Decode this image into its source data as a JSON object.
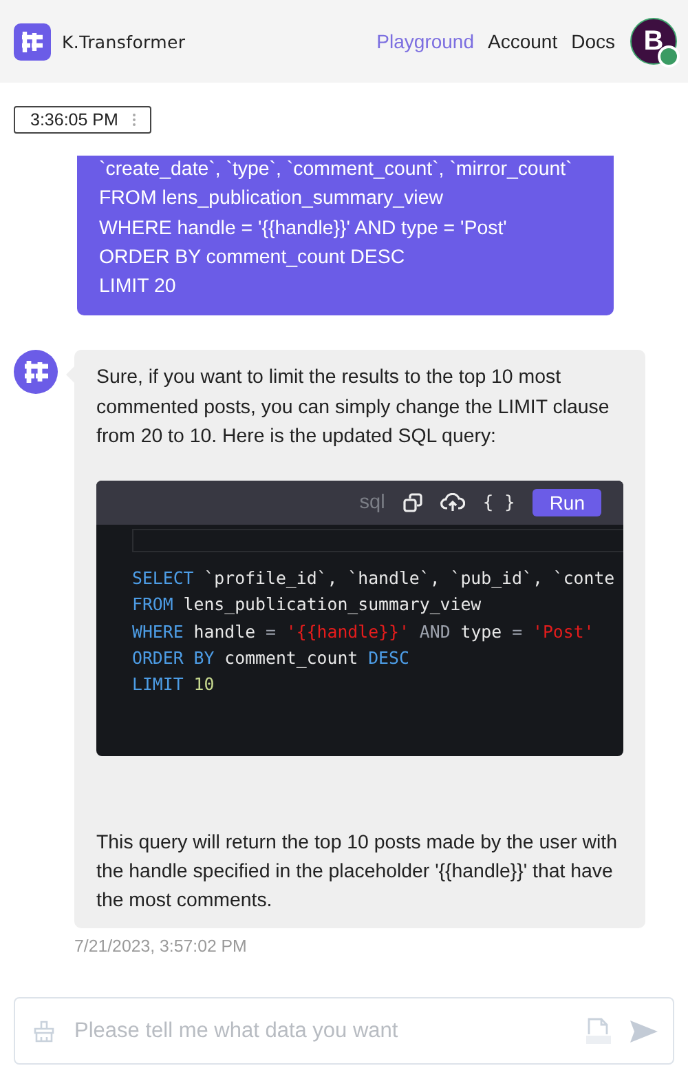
{
  "header": {
    "logo_text": "K.Transformer",
    "nav": [
      {
        "label": "Playground",
        "selected": true
      },
      {
        "label": "Account",
        "selected": false
      },
      {
        "label": "Docs",
        "selected": false
      }
    ],
    "avatar": {
      "initial": "B",
      "online": true
    }
  },
  "time_chip": {
    "time": "3:36:05 PM"
  },
  "user_message": {
    "lines": [
      "`create_date`, `type`, `comment_count`, `mirror_count`",
      "FROM lens_publication_summary_view",
      "WHERE handle = '{{handle}}' AND type = 'Post'",
      "ORDER BY comment_count DESC",
      "LIMIT 20"
    ]
  },
  "bot_message": {
    "intro": "Sure, if you want to limit the results to the top 10 most commented posts, you can simply change the LIMIT clause from 20 to 10. Here is the updated SQL query:",
    "code": {
      "language": "sql",
      "format_glyph": "{ }",
      "run_label": "Run",
      "lines": [
        [
          {
            "kind": "keyword",
            "text": "SELECT"
          },
          {
            "kind": "plain",
            "text": " `profile_id`, `handle`, `pub_id`, `conte"
          }
        ],
        [
          {
            "kind": "keyword",
            "text": "FROM"
          },
          {
            "kind": "plain",
            "text": " lens_publication_summary_view"
          }
        ],
        [
          {
            "kind": "keyword",
            "text": "WHERE"
          },
          {
            "kind": "plain",
            "text": " handle "
          },
          {
            "kind": "operator",
            "text": "= "
          },
          {
            "kind": "string",
            "text": "'{{handle}}' "
          },
          {
            "kind": "operator",
            "text": "AND"
          },
          {
            "kind": "plain",
            "text": " type "
          },
          {
            "kind": "operator",
            "text": "= "
          },
          {
            "kind": "string",
            "text": "'Post'"
          }
        ],
        [
          {
            "kind": "keyword",
            "text": "ORDER BY"
          },
          {
            "kind": "plain",
            "text": " comment_count "
          },
          {
            "kind": "keyword",
            "text": "DESC"
          }
        ],
        [
          {
            "kind": "keyword",
            "text": "LIMIT "
          },
          {
            "kind": "number",
            "text": "10"
          }
        ]
      ]
    },
    "outro": "This query will return the top 10 posts made by the user with the handle specified in the placeholder '{{handle}}' that have the most comments.",
    "timestamp": "7/21/2023, 3:57:02 PM"
  },
  "composer": {
    "placeholder": "Please tell me what data you want"
  }
}
